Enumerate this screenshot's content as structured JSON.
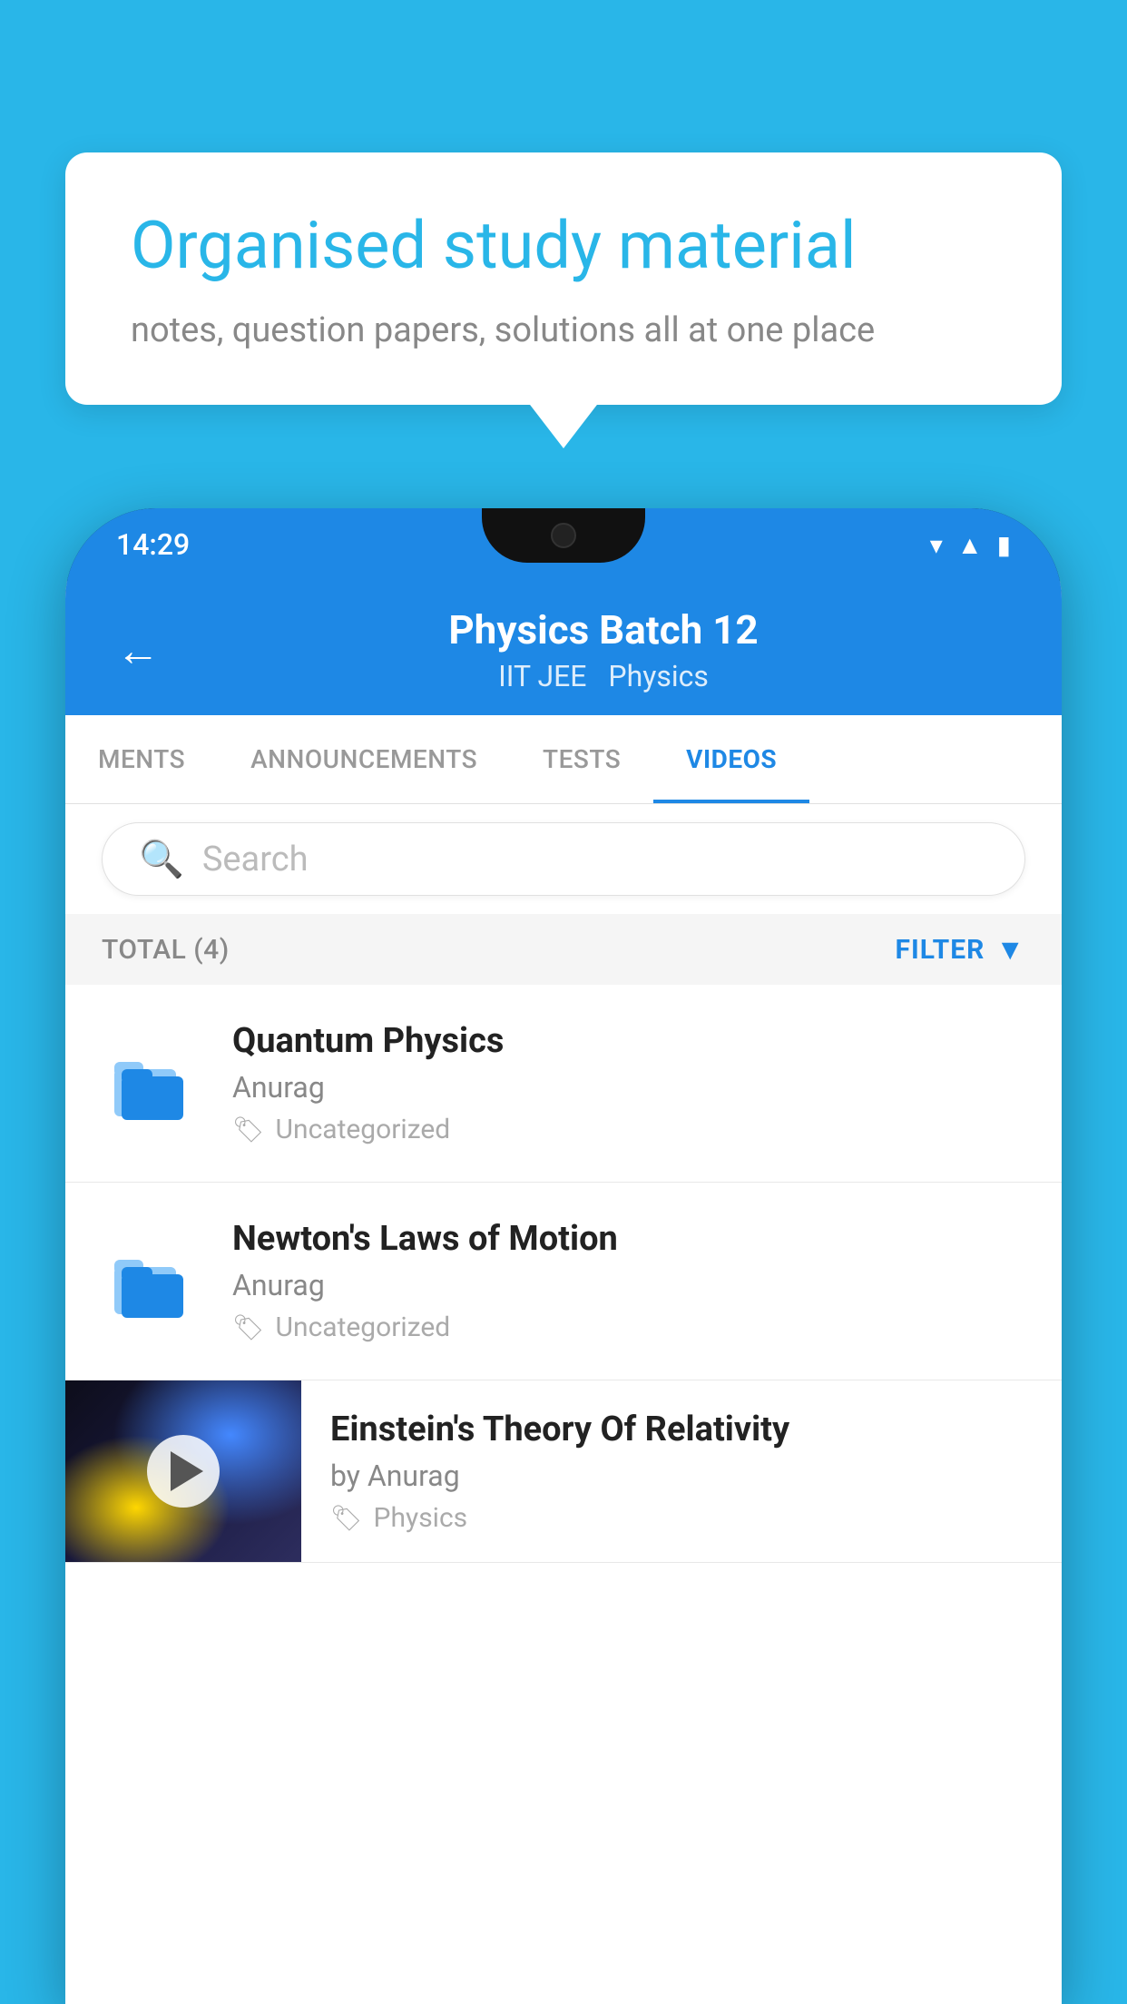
{
  "background_color": "#29b6e8",
  "bubble": {
    "title": "Organised study material",
    "subtitle": "notes, question papers, solutions all at one place"
  },
  "phone": {
    "status_bar": {
      "time": "14:29"
    },
    "header": {
      "back_label": "←",
      "title": "Physics Batch 12",
      "tag1": "IIT JEE",
      "tag2": "Physics"
    },
    "tabs": [
      {
        "label": "MENTS",
        "active": false
      },
      {
        "label": "ANNOUNCEMENTS",
        "active": false
      },
      {
        "label": "TESTS",
        "active": false
      },
      {
        "label": "VIDEOS",
        "active": true
      }
    ],
    "search": {
      "placeholder": "Search"
    },
    "filter_bar": {
      "total_label": "TOTAL (4)",
      "filter_label": "FILTER"
    },
    "videos": [
      {
        "title": "Quantum Physics",
        "author": "Anurag",
        "tag": "Uncategorized",
        "type": "folder"
      },
      {
        "title": "Newton's Laws of Motion",
        "author": "Anurag",
        "tag": "Uncategorized",
        "type": "folder"
      },
      {
        "title": "Einstein's Theory Of Relativity",
        "author": "by Anurag",
        "tag": "Physics",
        "type": "video"
      }
    ]
  }
}
